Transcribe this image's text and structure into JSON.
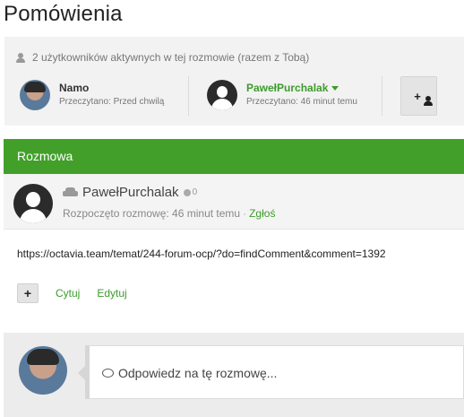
{
  "page": {
    "title": "Pomówienia"
  },
  "participants": {
    "active_text": "2 użytkowników aktywnych w tej rozmowie (razem z Tobą)",
    "items": [
      {
        "name": "Namo",
        "read": "Przeczytano: Przed chwilą"
      },
      {
        "name": "PawełPurchalak",
        "read": "Przeczytano: 46 minut temu"
      }
    ],
    "add_button": "+"
  },
  "section": {
    "title": "Rozmowa"
  },
  "post": {
    "author": "PawełPurchalak",
    "reputation": "0",
    "started": "Rozpoczęto rozmowę: 46 minut temu",
    "separator": "·",
    "report": "Zgłoś",
    "content": "https://octavia.team/temat/244-forum-ocp/?do=findComment&comment=1392",
    "actions": {
      "plus": "+",
      "quote": "Cytuj",
      "edit": "Edytuj"
    }
  },
  "reply": {
    "placeholder": "Odpowiedz na tę rozmowę..."
  },
  "colors": {
    "accent": "#42a02a",
    "link": "#3d9b2b"
  }
}
